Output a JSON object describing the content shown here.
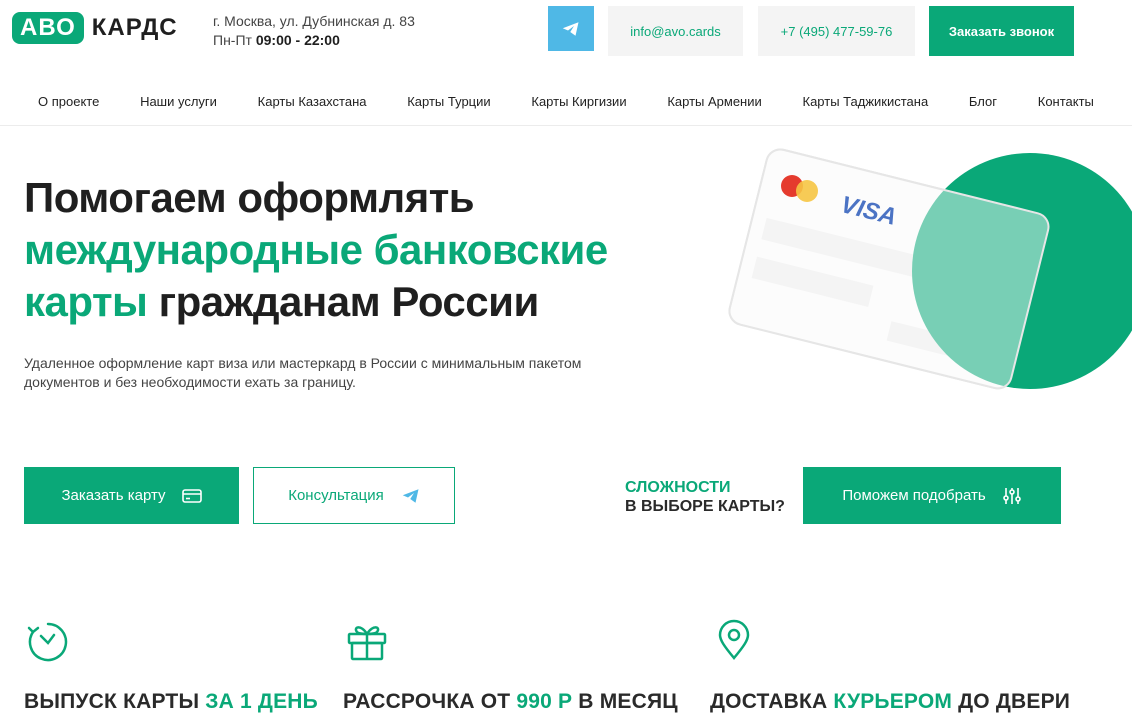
{
  "brand": {
    "badge": "АВО",
    "name": "КАРДС"
  },
  "header": {
    "address": "г. Москва, ул. Дубнинская д. 83",
    "hours_prefix": "Пн-Пт",
    "hours": "09:00 - 22:00",
    "email": "info@avo.cards",
    "phone": "+7 (495) 477-59-76",
    "callback_label": "Заказать звонок"
  },
  "nav": {
    "items": [
      {
        "label": "О проекте"
      },
      {
        "label": "Наши услуги"
      },
      {
        "label": "Карты Казахстана"
      },
      {
        "label": "Карты Турции"
      },
      {
        "label": "Карты Киргизии"
      },
      {
        "label": "Карты Армении"
      },
      {
        "label": "Карты Таджикистана"
      },
      {
        "label": "Блог"
      },
      {
        "label": "Контакты"
      }
    ]
  },
  "hero": {
    "title_line1": "Помогаем оформлять",
    "title_line2_green": "международные банковские",
    "title_line3_green": "карты",
    "title_line3_rest": " гражданам России",
    "subtitle": "Удаленное оформление карт виза или мастеркард в России с минимальным пакетом документов и без необходимости ехать за границу.",
    "card_brand": "VISA"
  },
  "actions": {
    "order_label": "Заказать карту",
    "consult_label": "Консультация",
    "difficulty_line1": "СЛОЖНОСТИ",
    "difficulty_line2": "В ВЫБОРЕ КАРТЫ?",
    "help_label": "Поможем подобрать"
  },
  "features": [
    {
      "icon": "clock-icon",
      "text_before": "ВЫПУСК КАРТЫ ",
      "text_green": "ЗА 1 ДЕНЬ",
      "text_after": ""
    },
    {
      "icon": "gift-icon",
      "text_before": "РАССРОЧКА ОТ ",
      "text_green": "990 Р",
      "text_after": " В МЕСЯЦ"
    },
    {
      "icon": "location-pin-icon",
      "text_before": "ДОСТАВКА ",
      "text_green": "КУРЬЕРОМ",
      "text_after": " ДО ДВЕРИ"
    }
  ],
  "colors": {
    "accent": "#0aa878",
    "telegram": "#4fb8e6",
    "light_bg": "#f4f4f4"
  }
}
